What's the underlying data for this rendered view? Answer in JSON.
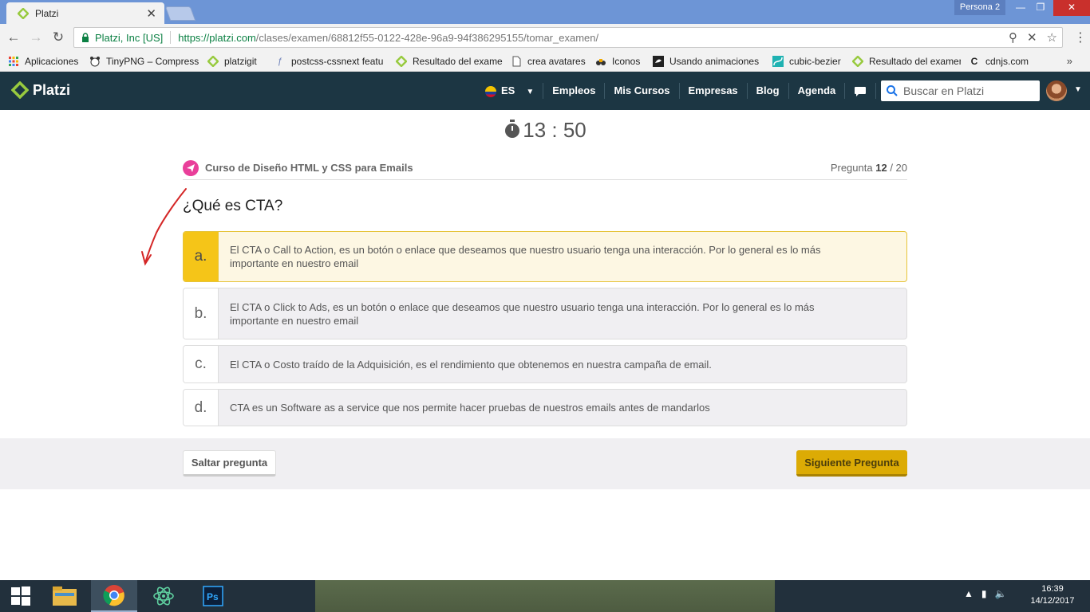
{
  "browser": {
    "tab_title": "Platzi",
    "profile": "Persona 2",
    "secure_label": "Platzi, Inc [US]",
    "url_host": "https://platzi.com",
    "url_path": "/clases/examen/68812f55-0122-428e-96a9-94f386295155/tomar_examen/",
    "bookmarks": [
      "Aplicaciones",
      "TinyPNG – Compress",
      "platzigit",
      "postcss-cssnext featu",
      "Resultado del examen",
      "crea avatares",
      "Iconos",
      "Usando animaciones",
      "cubic-bezier",
      "Resultado del examen",
      "cdnjs.com"
    ]
  },
  "header": {
    "logo": "Platzi",
    "lang": "ES",
    "nav": [
      "Empleos",
      "Mis Cursos",
      "Empresas",
      "Blog",
      "Agenda"
    ],
    "search_placeholder": "Buscar en Platzi"
  },
  "exam": {
    "timer": "13 : 50",
    "course": "Curso de Diseño HTML y CSS para Emails",
    "question_prefix": "Pregunta",
    "question_current": "12",
    "question_total": "/ 20",
    "question": "¿Qué es CTA?",
    "options": [
      {
        "letter": "a.",
        "text": "El CTA o Call to Action, es un botón o enlace que deseamos que nuestro usuario tenga una interacción. Por lo general es lo más importante en nuestro email"
      },
      {
        "letter": "b.",
        "text": "El CTA o Click to Ads, es un botón o enlace que deseamos que nuestro usuario tenga una interacción. Por lo general es lo más importante en nuestro email"
      },
      {
        "letter": "c.",
        "text": "El CTA o Costo traído de la Adquisición, es el rendimiento que obtenemos en nuestra campaña de email."
      },
      {
        "letter": "d.",
        "text": "CTA es un Software as a service que nos permite hacer pruebas de nuestros emails antes de mandarlos"
      }
    ],
    "selected_option": "a.",
    "skip_label": "Saltar pregunta",
    "next_label": "Siguiente Pregunta"
  },
  "taskbar": {
    "time": "16:39",
    "date": "14/12/2017"
  },
  "colors": {
    "header_bg": "#1c3643",
    "accent_green": "#98ca3f",
    "selected_yellow": "#f5c518",
    "next_button": "#dcab05"
  }
}
